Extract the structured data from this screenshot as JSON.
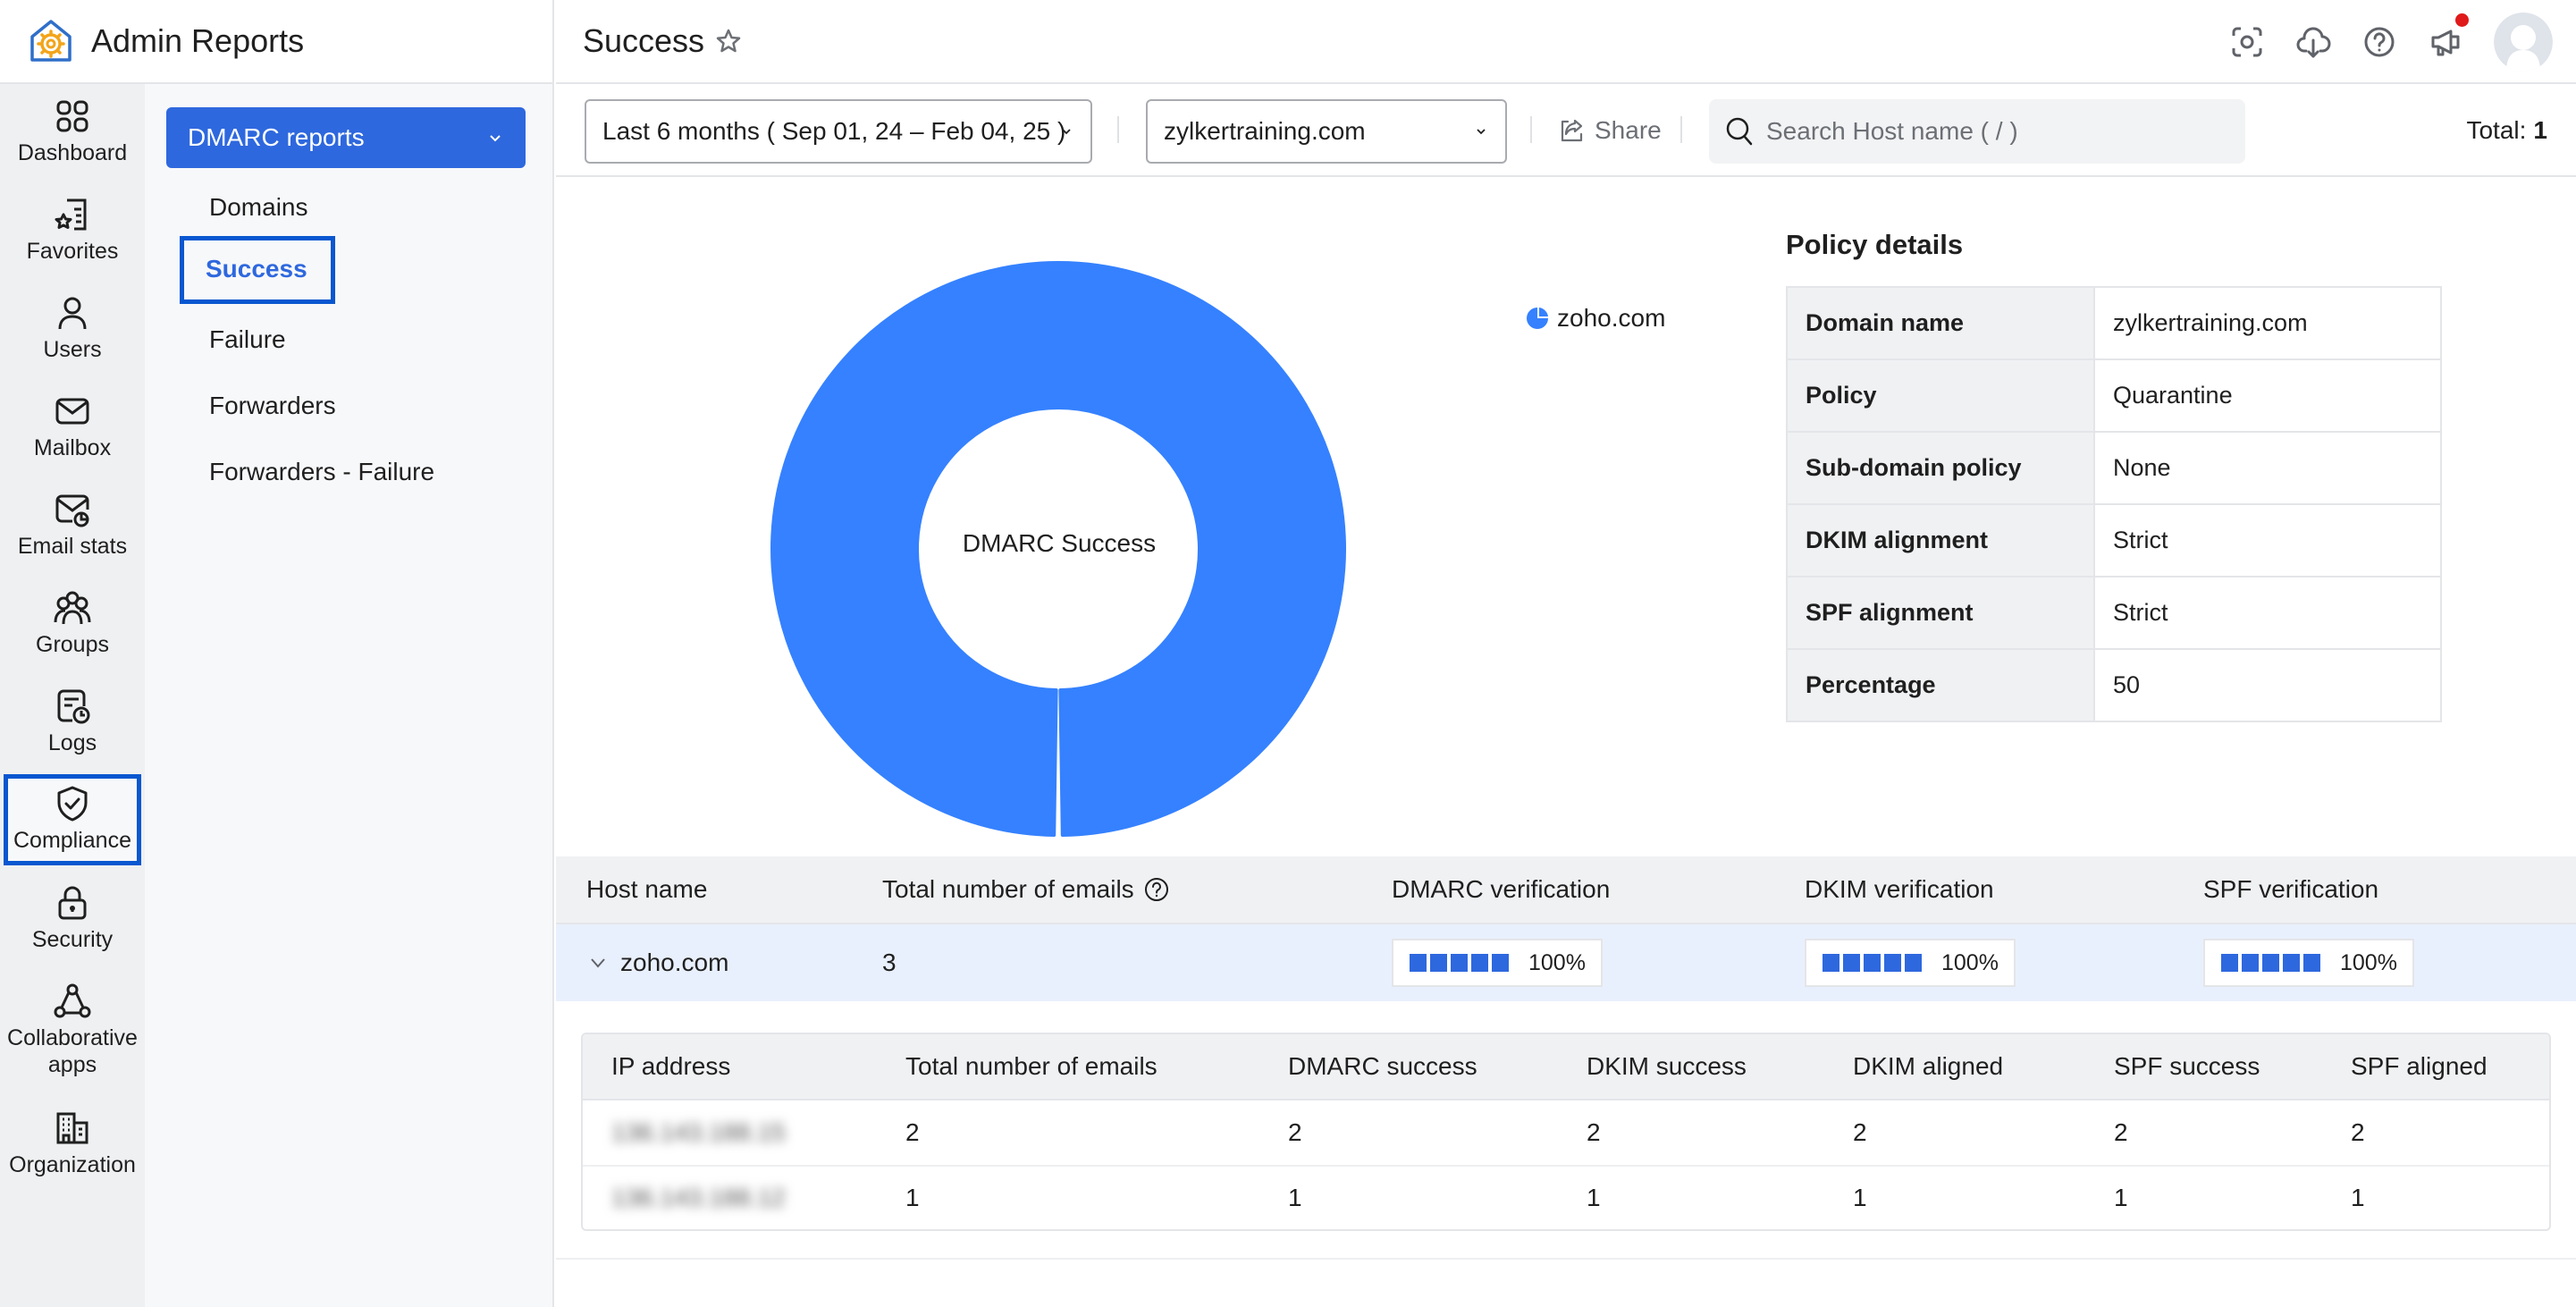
{
  "app": {
    "title": "Admin Reports",
    "logo_icon": "admin-reports-logo"
  },
  "rail": {
    "items": [
      {
        "label": "Dashboard",
        "icon": "dashboard-icon",
        "active": false
      },
      {
        "label": "Favorites",
        "icon": "favorites-icon",
        "active": false
      },
      {
        "label": "Users",
        "icon": "user-icon",
        "active": false
      },
      {
        "label": "Mailbox",
        "icon": "mail-icon",
        "active": false
      },
      {
        "label": "Email stats",
        "icon": "email-stats-icon",
        "active": false
      },
      {
        "label": "Groups",
        "icon": "groups-icon",
        "active": false
      },
      {
        "label": "Logs",
        "icon": "logs-icon",
        "active": false
      },
      {
        "label": "Compliance",
        "icon": "shield-check-icon",
        "active": true
      },
      {
        "label": "Security",
        "icon": "lock-icon",
        "active": false
      },
      {
        "label": "Collaborative apps",
        "icon": "collaborative-apps-icon",
        "active": false
      },
      {
        "label": "Organization",
        "icon": "organization-icon",
        "active": false
      }
    ]
  },
  "submenu": {
    "group_label": "DMARC reports",
    "items": [
      {
        "label": "Domains",
        "active": false
      },
      {
        "label": "Success",
        "active": true
      },
      {
        "label": "Failure",
        "active": false
      },
      {
        "label": "Forwarders",
        "active": false
      },
      {
        "label": "Forwarders - Failure",
        "active": false
      }
    ]
  },
  "header": {
    "page_title": "Success",
    "icons": [
      "screenshot-icon",
      "cloud-download-icon",
      "help-icon",
      "announcement-icon",
      "avatar"
    ],
    "has_notification": true
  },
  "toolbar": {
    "date_range": "Last 6 months ( Sep 01, 24 – Feb 04, 25 )",
    "domain": "zylkertraining.com",
    "share_label": "Share",
    "search_placeholder": "Search Host name ( / )",
    "total_label": "Total:",
    "total_value": "1"
  },
  "chart_data": {
    "type": "pie",
    "variant": "donut",
    "title": "DMARC Success",
    "categories": [
      "zoho.com"
    ],
    "values": [
      3
    ],
    "colors": [
      "#3581ff"
    ],
    "legend": [
      "zoho.com"
    ],
    "legend_position": "right"
  },
  "policy": {
    "title": "Policy details",
    "rows": [
      {
        "key": "Domain name",
        "value": "zylkertraining.com"
      },
      {
        "key": "Policy",
        "value": "Quarantine"
      },
      {
        "key": "Sub-domain policy",
        "value": "None"
      },
      {
        "key": "DKIM alignment",
        "value": "Strict"
      },
      {
        "key": "SPF alignment",
        "value": "Strict"
      },
      {
        "key": "Percentage",
        "value": "50"
      }
    ]
  },
  "hosts": {
    "columns": [
      "Host name",
      "Total number of emails",
      "DMARC verification",
      "DKIM verification",
      "SPF verification"
    ],
    "rows": [
      {
        "host": "zoho.com",
        "total": "3",
        "dmarc": "100%",
        "dmarc_fraction": 1.0,
        "dkim": "100%",
        "dkim_fraction": 1.0,
        "spf": "100%",
        "spf_fraction": 1.0,
        "expanded": true
      }
    ]
  },
  "ip_details": {
    "columns": [
      "IP address",
      "Total number of emails",
      "DMARC success",
      "DKIM success",
      "DKIM aligned",
      "SPF success",
      "SPF aligned"
    ],
    "rows": [
      {
        "ip": "136.143.188.15",
        "total": "2",
        "dmarc_success": "2",
        "dkim_success": "2",
        "dkim_aligned": "2",
        "spf_success": "2",
        "spf_aligned": "2"
      },
      {
        "ip": "136.143.188.12",
        "total": "1",
        "dmarc_success": "1",
        "dkim_success": "1",
        "dkim_aligned": "1",
        "spf_success": "1",
        "spf_aligned": "1"
      }
    ],
    "ip_blurred": true
  },
  "colors": {
    "accent": "#2e68de",
    "highlight_border": "#0957d0",
    "chart_blue": "#3581ff",
    "notification": "#e01a1a",
    "row_selected": "#e9f0fd"
  }
}
